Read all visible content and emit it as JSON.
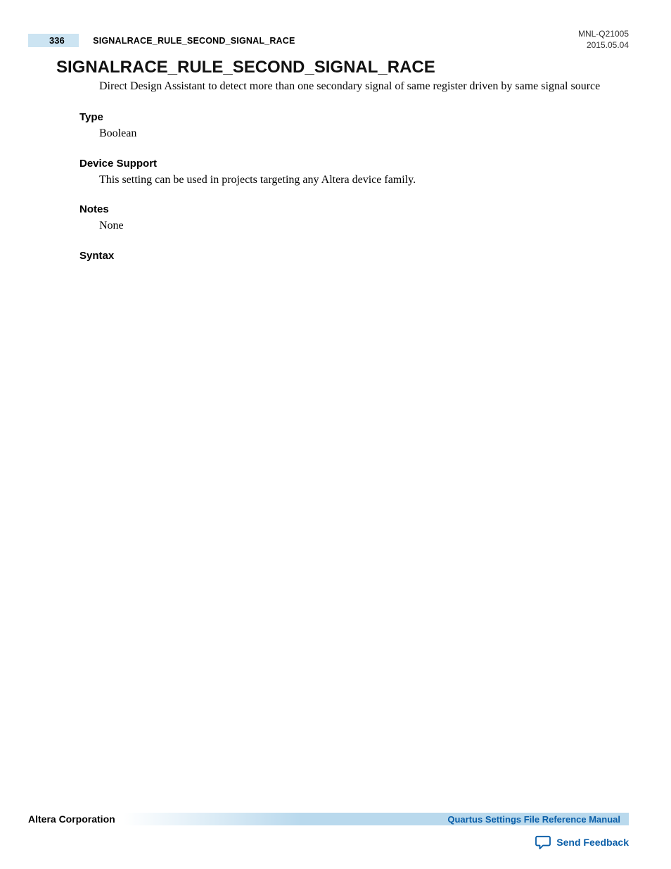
{
  "header": {
    "page_number": "336",
    "running_title": "SIGNALRACE_RULE_SECOND_SIGNAL_RACE",
    "doc_id": "MNL-Q21005",
    "date": "2015.05.04"
  },
  "title": "SIGNALRACE_RULE_SECOND_SIGNAL_RACE",
  "description": "Direct Design Assistant to detect more than one secondary signal of same register driven by same signal source",
  "sections": {
    "type": {
      "label": "Type",
      "body": "Boolean"
    },
    "device_support": {
      "label": "Device Support",
      "body": "This setting can be used in projects targeting any Altera device family."
    },
    "notes": {
      "label": "Notes",
      "body": "None"
    },
    "syntax": {
      "label": "Syntax",
      "body": ""
    }
  },
  "footer": {
    "company": "Altera Corporation",
    "manual_link": "Quartus Settings File Reference Manual",
    "feedback": "Send Feedback"
  }
}
